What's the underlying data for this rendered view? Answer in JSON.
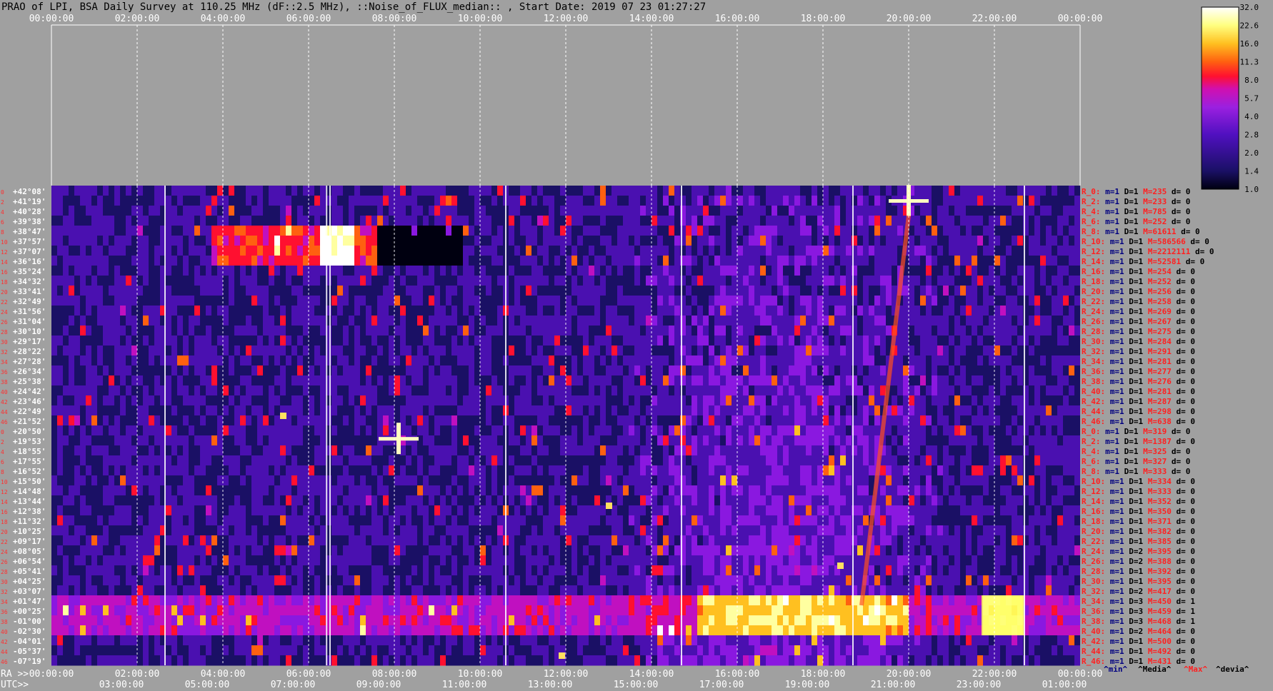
{
  "title": "PRAO of LPI, BSA Daily Survey at 110.25 MHz (dF::2.5 MHz), ::Noise_of_FLUX_median:: , Start Date: 2019 07 23 01:27:27",
  "colors": {
    "background": "#a0a0a0",
    "plot_bg": "#16123a",
    "colormap": [
      "#000010",
      "#1a1065",
      "#4a10b0",
      "#8a18e0",
      "#c010c0",
      "#ff1030",
      "#ff6010",
      "#ffc020",
      "#ffffa0",
      "#ffffff"
    ],
    "stat_red": "#ff2020",
    "stat_navy": "#000080",
    "white": "#ffffff"
  },
  "chart_data": {
    "type": "heatmap",
    "title": "PRAO of LPI, BSA Daily Survey at 110.25 MHz (dF::2.5 MHz), ::Noise_of_FLUX_median:: , Start Date: 2019 07 23 01:27:27",
    "x_top_ticks": [
      "00:00:00",
      "02:00:00",
      "04:00:00",
      "06:00:00",
      "08:00:00",
      "10:00:00",
      "12:00:00",
      "14:00:00",
      "16:00:00",
      "18:00:00",
      "20:00:00",
      "22:00:00",
      "00:00:00"
    ],
    "x_ra_label": "RA >>",
    "x_ra_ticks": [
      "00:00:00",
      "02:00:00",
      "04:00:00",
      "06:00:00",
      "08:00:00",
      "10:00:00",
      "12:00:00",
      "14:00:00",
      "16:00:00",
      "18:00:00",
      "20:00:00",
      "22:00:00",
      "00:00:00"
    ],
    "x_utc_label": "UTC>>",
    "x_utc_ticks": [
      "03:00:00",
      "05:00:00",
      "07:00:00",
      "09:00:00",
      "11:00:00",
      "13:00:00",
      "15:00:00",
      "17:00:00",
      "19:00:00",
      "21:00:00",
      "23:00:00",
      "01:00:00"
    ],
    "y_dec_labels": [
      "+42°08'",
      "+41°19'",
      "+40°28'",
      "+39°38'",
      "+38°47'",
      "+37°57'",
      "+37°07'",
      "+36°16'",
      "+35°24'",
      "+34°32'",
      "+33°41'",
      "+32°49'",
      "+31°56'",
      "+31°04'",
      "+30°10'",
      "+29°17'",
      "+28°22'",
      "+27°28'",
      "+26°34'",
      "+25°38'",
      "+24°42'",
      "+23°46'",
      "+22°49'",
      "+21°52'",
      "+20°50'",
      "+19°53'",
      "+18°55'",
      "+17°55'",
      "+16°52'",
      "+15°50'",
      "+14°48'",
      "+13°44'",
      "+12°38'",
      "+11°32'",
      "+10°25'",
      "+09°17'",
      "+08°05'",
      "+06°54'",
      "+05°41'",
      "+04°25'",
      "+03°07'",
      "+01°47'",
      "+00°25'",
      "-01°00'",
      "-02°30'",
      "-04°01'",
      "-05°37'",
      "-07°19'"
    ],
    "row_indices": [
      "0",
      "2",
      "4",
      "6",
      "8",
      "10",
      "12",
      "14",
      "16",
      "18",
      "20",
      "22",
      "24",
      "26",
      "28",
      "30",
      "32",
      "34",
      "36",
      "38",
      "40",
      "42",
      "44",
      "46",
      "0",
      "2",
      "4",
      "6",
      "8",
      "10",
      "12",
      "14",
      "16",
      "18",
      "20",
      "22",
      "24",
      "26",
      "28",
      "30",
      "32",
      "34",
      "36",
      "38",
      "40",
      "42",
      "44",
      "46"
    ],
    "colorbar": {
      "ticks": [
        "32.0",
        "22.6",
        "16.0",
        "11.3",
        "8.0",
        "5.7",
        "4.0",
        "2.8",
        "2.0",
        "1.4",
        "1.0"
      ],
      "scale": "log"
    },
    "row_stats": [
      {
        "r": "R_0:",
        "m": "m=1",
        "d": "D=1",
        "M": "M=235",
        "dv": "d= 0"
      },
      {
        "r": "R_2:",
        "m": "m=1",
        "d": "D=1",
        "M": "M=233",
        "dv": "d= 0"
      },
      {
        "r": "R_4:",
        "m": "m=1",
        "d": "D=1",
        "M": "M=785",
        "dv": "d= 0"
      },
      {
        "r": "R_6:",
        "m": "m=1",
        "d": "D=1",
        "M": "M=252",
        "dv": "d= 0"
      },
      {
        "r": "R_8:",
        "m": "m=1",
        "d": "D=1",
        "M": "M=61611",
        "dv": "d= 0"
      },
      {
        "r": "R_10:",
        "m": "m=1",
        "d": "D=1",
        "M": "M=586566",
        "dv": "d= 0"
      },
      {
        "r": "R_12:",
        "m": "m=1",
        "d": "D=1",
        "M": "M=2212111",
        "dv": "d= 0"
      },
      {
        "r": "R_14:",
        "m": "m=1",
        "d": "D=1",
        "M": "M=52581",
        "dv": "d= 0"
      },
      {
        "r": "R_16:",
        "m": "m=1",
        "d": "D=1",
        "M": "M=254",
        "dv": "d= 0"
      },
      {
        "r": "R_18:",
        "m": "m=1",
        "d": "D=1",
        "M": "M=252",
        "dv": "d= 0"
      },
      {
        "r": "R_20:",
        "m": "m=1",
        "d": "D=1",
        "M": "M=256",
        "dv": "d= 0"
      },
      {
        "r": "R_22:",
        "m": "m=1",
        "d": "D=1",
        "M": "M=258",
        "dv": "d= 0"
      },
      {
        "r": "R_24:",
        "m": "m=1",
        "d": "D=1",
        "M": "M=269",
        "dv": "d= 0"
      },
      {
        "r": "R_26:",
        "m": "m=1",
        "d": "D=1",
        "M": "M=267",
        "dv": "d= 0"
      },
      {
        "r": "R_28:",
        "m": "m=1",
        "d": "D=1",
        "M": "M=275",
        "dv": "d= 0"
      },
      {
        "r": "R_30:",
        "m": "m=1",
        "d": "D=1",
        "M": "M=284",
        "dv": "d= 0"
      },
      {
        "r": "R_32:",
        "m": "m=1",
        "d": "D=1",
        "M": "M=291",
        "dv": "d= 0"
      },
      {
        "r": "R_34:",
        "m": "m=1",
        "d": "D=1",
        "M": "M=281",
        "dv": "d= 0"
      },
      {
        "r": "R_36:",
        "m": "m=1",
        "d": "D=1",
        "M": "M=277",
        "dv": "d= 0"
      },
      {
        "r": "R_38:",
        "m": "m=1",
        "d": "D=1",
        "M": "M=276",
        "dv": "d= 0"
      },
      {
        "r": "R_40:",
        "m": "m=1",
        "d": "D=1",
        "M": "M=281",
        "dv": "d= 0"
      },
      {
        "r": "R_42:",
        "m": "m=1",
        "d": "D=1",
        "M": "M=287",
        "dv": "d= 0"
      },
      {
        "r": "R_44:",
        "m": "m=1",
        "d": "D=1",
        "M": "M=298",
        "dv": "d= 0"
      },
      {
        "r": "R_46:",
        "m": "m=1",
        "d": "D=1",
        "M": "M=638",
        "dv": "d= 0"
      },
      {
        "r": "R_0:",
        "m": "m=1",
        "d": "D=1",
        "M": "M=319",
        "dv": "d= 0"
      },
      {
        "r": "R_2:",
        "m": "m=1",
        "d": "D=1",
        "M": "M=1387",
        "dv": "d= 0"
      },
      {
        "r": "R_4:",
        "m": "m=1",
        "d": "D=1",
        "M": "M=325",
        "dv": "d= 0"
      },
      {
        "r": "R_6:",
        "m": "m=1",
        "d": "D=1",
        "M": "M=327",
        "dv": "d= 0"
      },
      {
        "r": "R_8:",
        "m": "m=1",
        "d": "D=1",
        "M": "M=333",
        "dv": "d= 0"
      },
      {
        "r": "R_10:",
        "m": "m=1",
        "d": "D=1",
        "M": "M=334",
        "dv": "d= 0"
      },
      {
        "r": "R_12:",
        "m": "m=1",
        "d": "D=1",
        "M": "M=333",
        "dv": "d= 0"
      },
      {
        "r": "R_14:",
        "m": "m=1",
        "d": "D=1",
        "M": "M=352",
        "dv": "d= 0"
      },
      {
        "r": "R_16:",
        "m": "m=1",
        "d": "D=1",
        "M": "M=350",
        "dv": "d= 0"
      },
      {
        "r": "R_18:",
        "m": "m=1",
        "d": "D=1",
        "M": "M=371",
        "dv": "d= 0"
      },
      {
        "r": "R_20:",
        "m": "m=1",
        "d": "D=1",
        "M": "M=382",
        "dv": "d= 0"
      },
      {
        "r": "R_22:",
        "m": "m=1",
        "d": "D=1",
        "M": "M=385",
        "dv": "d= 0"
      },
      {
        "r": "R_24:",
        "m": "m=1",
        "d": "D=2",
        "M": "M=395",
        "dv": "d= 0"
      },
      {
        "r": "R_26:",
        "m": "m=1",
        "d": "D=2",
        "M": "M=388",
        "dv": "d= 0"
      },
      {
        "r": "R_28:",
        "m": "m=1",
        "d": "D=1",
        "M": "M=392",
        "dv": "d= 0"
      },
      {
        "r": "R_30:",
        "m": "m=1",
        "d": "D=1",
        "M": "M=395",
        "dv": "d= 0"
      },
      {
        "r": "R_32:",
        "m": "m=1",
        "d": "D=2",
        "M": "M=417",
        "dv": "d= 0"
      },
      {
        "r": "R_34:",
        "m": "m=1",
        "d": "D=3",
        "M": "M=450",
        "dv": "d= 1"
      },
      {
        "r": "R_36:",
        "m": "m=1",
        "d": "D=3",
        "M": "M=459",
        "dv": "d= 1"
      },
      {
        "r": "R_38:",
        "m": "m=1",
        "d": "D=3",
        "M": "M=468",
        "dv": "d= 1"
      },
      {
        "r": "R_40:",
        "m": "m=1",
        "d": "D=2",
        "M": "M=464",
        "dv": "d= 0"
      },
      {
        "r": "R_42:",
        "m": "m=1",
        "d": "D=1",
        "M": "M=500",
        "dv": "d= 0"
      },
      {
        "r": "R_44:",
        "m": "m=1",
        "d": "D=1",
        "M": "M=492",
        "dv": "d= 0"
      },
      {
        "r": "R_46:",
        "m": "m=1",
        "d": "D=1",
        "M": "M=431",
        "dv": "d= 0"
      }
    ],
    "legend_notes": {
      "min": "^min^",
      "median": "^Media^",
      "max": "^Max^",
      "dev": "^devia^"
    }
  }
}
